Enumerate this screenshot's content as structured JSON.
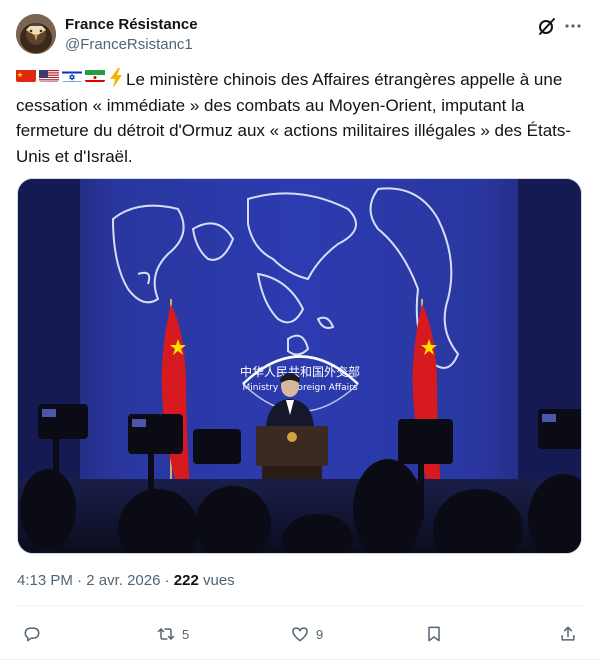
{
  "author": {
    "display_name": "France Résistance",
    "handle": "@FranceRsistanc1"
  },
  "tweet": {
    "text": "Le ministère chinois des Affaires étrangères appelle à une cessation « immédiate » des combats au Moyen-Orient, imputant la fermeture du détroit d'Ormuz aux « actions militaires illégales » des États-Unis et d'Israël.",
    "prefix_icons": [
      "china-flag-icon",
      "usa-flag-icon",
      "israel-flag-icon",
      "iran-flag-icon",
      "lightning-icon"
    ]
  },
  "media": {
    "backdrop_text_cn": "中华人民共和国外交部",
    "backdrop_text_en": "Ministry of Foreign Affairs",
    "background_color": "#24308a"
  },
  "meta": {
    "time": "4:13 PM",
    "separator": " · ",
    "date": "2 avr. 2026",
    "views_count": "222",
    "views_label": " vues"
  },
  "actions": {
    "reply_icon": "reply-icon",
    "retweet_icon": "retweet-icon",
    "retweet_count": "5",
    "like_icon": "heart-icon",
    "like_count": "9",
    "bookmark_icon": "bookmark-icon",
    "share_icon": "share-icon"
  },
  "colors": {
    "text": "#0f1419",
    "secondary": "#536471",
    "border": "#eff3f4"
  }
}
